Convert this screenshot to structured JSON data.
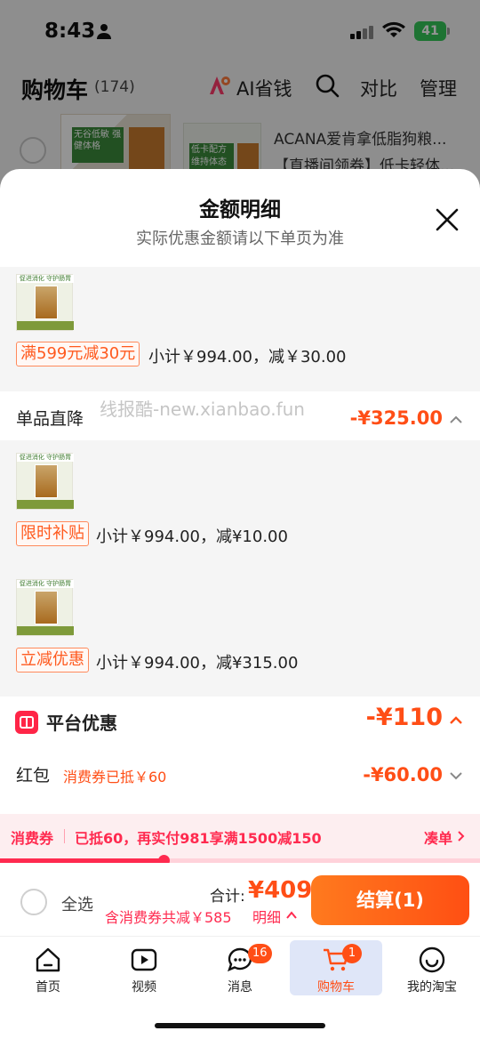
{
  "status_bar": {
    "time": "8:43",
    "battery": "41"
  },
  "cart_header": {
    "title": "购物车",
    "count": "(174)",
    "ai_label": "AI省钱",
    "compare_label": "对比",
    "manage_label": "管理"
  },
  "background_item": {
    "name": "ACANA爱肯拿低脂狗粮...",
    "subtitle": "【直播间领券】低卡轻体...",
    "thumb1_tag": "无谷低敏 强健体格",
    "thumb2_tag": "低卡配方 维持体态"
  },
  "sheet": {
    "title": "金额明细",
    "subtitle": "实际优惠金额请以下单页为准",
    "thumb_band": "促进消化 守护肠胃",
    "group1": {
      "tag": "满599元减30元",
      "subtotal": "小计￥994.00，减￥30.00"
    },
    "single_drop": {
      "label": "单品直降",
      "amount": "-¥325.00"
    },
    "group2": {
      "tag": "限时补贴",
      "subtotal": "小计￥994.00，减¥10.00"
    },
    "group3": {
      "tag": "立减优惠",
      "subtotal": "小计￥994.00，减¥315.00"
    },
    "platform": {
      "label": "平台优惠",
      "amount": "-¥110"
    },
    "red_packet": {
      "label": "红包",
      "note": "消费券已抵￥60",
      "amount": "-¥60.00"
    },
    "watermark": "线报酷-new.xianbao.fun"
  },
  "coupon_bar": {
    "label": "消费券",
    "text": "已抵60，再实付981享满1500减150",
    "link": "凑单",
    "progress": 0.34
  },
  "checkout": {
    "select_all": "全选",
    "total_label": "合计:",
    "total_amount": "¥409",
    "note": "含消费券共减￥585",
    "detail": "明细",
    "button": "结算(1)"
  },
  "tabs": [
    {
      "label": "首页",
      "icon": "home-icon"
    },
    {
      "label": "视频",
      "icon": "video-icon"
    },
    {
      "label": "消息",
      "icon": "message-icon",
      "badge": "16"
    },
    {
      "label": "购物车",
      "icon": "cart-icon",
      "badge": "1",
      "active": true
    },
    {
      "label": "我的淘宝",
      "icon": "profile-icon"
    }
  ],
  "colors": {
    "accent": "#ff4e16",
    "coupon": "#ff2a4f",
    "active_tab_bg": "#dfe6f8"
  }
}
